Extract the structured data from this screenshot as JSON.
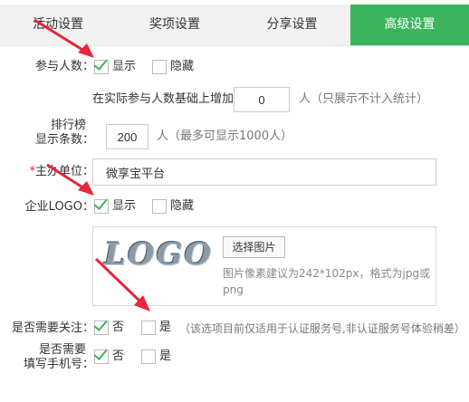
{
  "tabs": [
    {
      "label": "活动设置",
      "active": false
    },
    {
      "label": "奖项设置",
      "active": false
    },
    {
      "label": "分享设置",
      "active": false
    },
    {
      "label": "高级设置",
      "active": true
    }
  ],
  "participants": {
    "label": "参与人数：",
    "show_label": "显示",
    "show_checked": true,
    "hide_label": "隐藏",
    "hide_checked": false,
    "increase_prefix": "在实际参与人数基础上增加",
    "increase_value": "0",
    "increase_suffix": "人（只展示不计入统计）"
  },
  "ranking": {
    "label_line1": "排行榜",
    "label_line2": "显示条数：",
    "value": "200",
    "suffix": "人（最多可显示1000人）"
  },
  "organizer": {
    "required_mark": "*",
    "label": "主办单位：",
    "value": "微享宝平台"
  },
  "company_logo": {
    "label": "企业LOGO：",
    "show_label": "显示",
    "show_checked": true,
    "hide_label": "隐藏",
    "hide_checked": false,
    "logo_text": "LOGO",
    "choose_button": "选择图片",
    "hint": "图片像素建议为242*102px，格式为jpg或png"
  },
  "need_follow": {
    "label": "是否需要关注：",
    "no_label": "否",
    "no_checked": true,
    "yes_label": "是",
    "yes_checked": false,
    "note": "（该选项目前仅适用于认证服务号,非认证服务号体验稍差）"
  },
  "need_phone": {
    "label_line1": "是否需要",
    "label_line2": "填写手机号：",
    "no_label": "否",
    "no_checked": true,
    "yes_label": "是",
    "yes_checked": false
  },
  "colors": {
    "accent": "#3bb55b",
    "arrow": "#e8253a"
  }
}
